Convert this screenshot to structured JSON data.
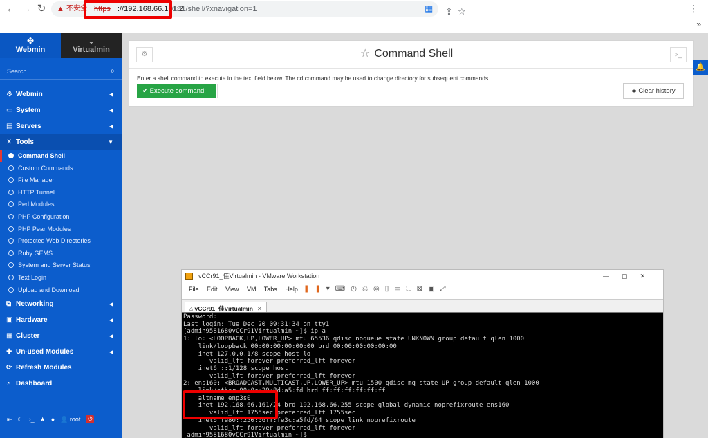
{
  "browser": {
    "warning_text": "不安全",
    "url_scheme": "https",
    "url_host": "://192.168.66.161:2",
    "url_path": "0181/shell/?xnavigation=1",
    "more_label": "»"
  },
  "sidebar": {
    "tabs": [
      {
        "label": "Webmin"
      },
      {
        "label": "Virtualmin"
      }
    ],
    "search_placeholder": "Search",
    "items": [
      {
        "label": "Webmin",
        "icon": "gear-icon"
      },
      {
        "label": "System",
        "icon": "monitor-icon"
      },
      {
        "label": "Servers",
        "icon": "server-icon"
      },
      {
        "label": "Tools",
        "icon": "wrench-icon"
      }
    ],
    "tools_sub": [
      "Command Shell",
      "Custom Commands",
      "File Manager",
      "HTTP Tunnel",
      "Perl Modules",
      "PHP Configuration",
      "PHP Pear Modules",
      "Protected Web Directories",
      "Ruby GEMS",
      "System and Server Status",
      "Text Login",
      "Upload and Download"
    ],
    "items_after": [
      {
        "label": "Networking",
        "icon": "network-icon"
      },
      {
        "label": "Hardware",
        "icon": "hardware-icon"
      },
      {
        "label": "Cluster",
        "icon": "cluster-icon"
      },
      {
        "label": "Un-used Modules",
        "icon": "puzzle-icon"
      },
      {
        "label": "Refresh Modules",
        "icon": "refresh-icon"
      },
      {
        "label": "Dashboard",
        "icon": "dashboard-icon"
      }
    ],
    "bottom_user": "root"
  },
  "shell": {
    "title": "Command Shell",
    "description": "Enter a shell command to execute in the text field below. The cd command may be used to change directory for subsequent commands.",
    "execute_label": "Execute command:",
    "clear_label": "Clear history"
  },
  "vmware": {
    "title": "vCCr91_佳Virtualmin - VMware Workstation",
    "menu": [
      "File",
      "Edit",
      "View",
      "VM",
      "Tabs",
      "Help"
    ],
    "tab_label": "vCCr91_佳Virtualmin",
    "terminal_lines": [
      "Password:",
      "Last login: Tue Dec 20 09:31:34 on tty1",
      "[admin9581680vCCr91Virtualmin ~]$ ip a",
      "1: lo: <LOOPBACK,UP,LOWER_UP> mtu 65536 qdisc noqueue state UNKNOWN group default qlen 1000",
      "    link/loopback 00:00:00:00:00:00 brd 00:00:00:00:00:00",
      "    inet 127.0.0.1/8 scope host lo",
      "       valid_lft forever preferred_lft forever",
      "    inet6 ::1/128 scope host",
      "       valid_lft forever preferred_lft forever",
      "2: ens160: <BROADCAST,MULTICAST,UP,LOWER_UP> mtu 1500 qdisc mq state UP group default qlen 1000",
      "    link/ether 00:0c:29:8d:a5:fd brd ff:ff:ff:ff:ff:ff",
      "    altname enp3s0",
      "    inet 192.168.66.161/24 brd 192.168.66.255 scope global dynamic noprefixroute ens160",
      "       valid_lft 1755sec preferred_lft 1755sec",
      "    inet6 fe80::250:56ff:fe3c:a5fd/64 scope link noprefixroute",
      "       valid_lft forever preferred_lft forever",
      "[admin9581680vCCr91Virtualmin ~]$"
    ]
  }
}
